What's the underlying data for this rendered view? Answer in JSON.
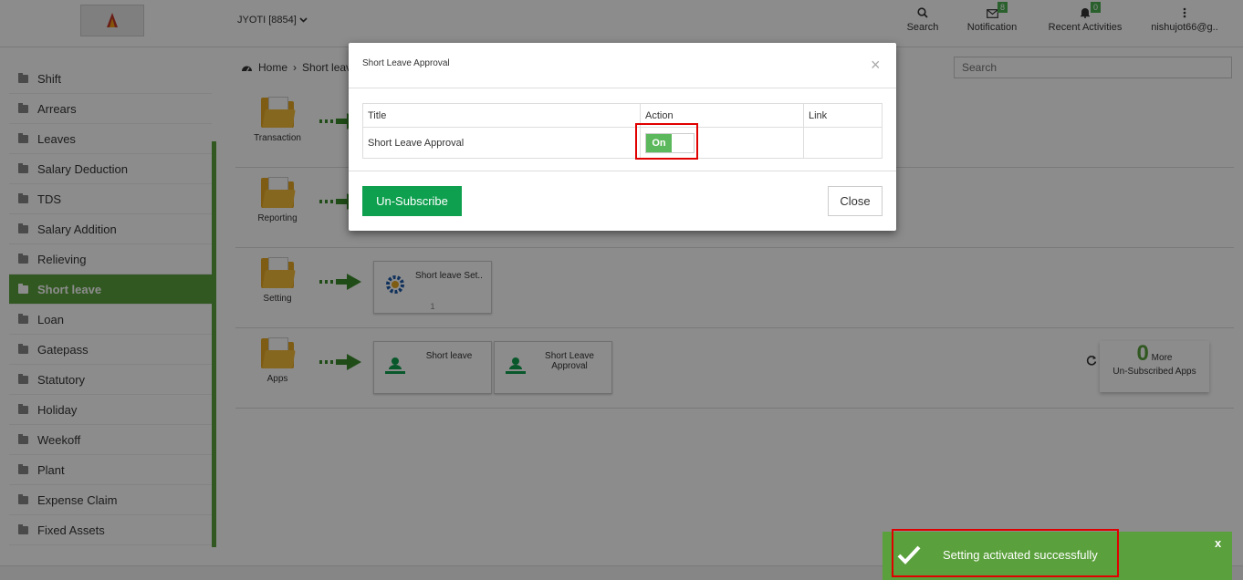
{
  "header": {
    "user_switch": "JYOTI [8854]",
    "search_label": "Search",
    "notification_label": "Notification",
    "notification_count": "8",
    "activities_label": "Recent Activities",
    "activities_count": "0",
    "user_email": "nishujot66@g.."
  },
  "sidebar": {
    "items": [
      {
        "label": "Shift"
      },
      {
        "label": "Arrears"
      },
      {
        "label": "Leaves"
      },
      {
        "label": "Salary Deduction"
      },
      {
        "label": "TDS"
      },
      {
        "label": "Salary Addition"
      },
      {
        "label": "Relieving"
      },
      {
        "label": "Short leave",
        "active": true
      },
      {
        "label": "Loan"
      },
      {
        "label": "Gatepass"
      },
      {
        "label": "Statutory"
      },
      {
        "label": "Holiday"
      },
      {
        "label": "Weekoff"
      },
      {
        "label": "Plant"
      },
      {
        "label": "Expense Claim"
      },
      {
        "label": "Fixed Assets"
      }
    ]
  },
  "main": {
    "breadcrumb": {
      "home": "Home",
      "current": "Short leave"
    },
    "search_placeholder": "Search",
    "categories": [
      {
        "label": "Transaction"
      },
      {
        "label": "Reporting"
      },
      {
        "label": "Setting",
        "tiles": [
          {
            "name": "Short leave Set..",
            "count": "1"
          }
        ]
      },
      {
        "label": "Apps",
        "tiles": [
          {
            "name": "Short leave"
          },
          {
            "name": "Short Leave Approval"
          }
        ]
      }
    ],
    "unsubscribed": {
      "count": "0",
      "more": "More",
      "label": "Un-Subscribed Apps"
    }
  },
  "modal": {
    "title": "Short Leave Approval",
    "columns": [
      "Title",
      "Action",
      "Link"
    ],
    "row": {
      "title": "Short Leave Approval",
      "action": "On",
      "link": ""
    },
    "unsubscribe_button": "Un-Subscribe",
    "close_button": "Close"
  },
  "toast": {
    "message": "Setting activated successfully",
    "close": "x"
  },
  "colors": {
    "accent": "#5aa03c",
    "button_green": "#0fa04f",
    "highlight": "#e00000",
    "folder": "#e6a824"
  }
}
